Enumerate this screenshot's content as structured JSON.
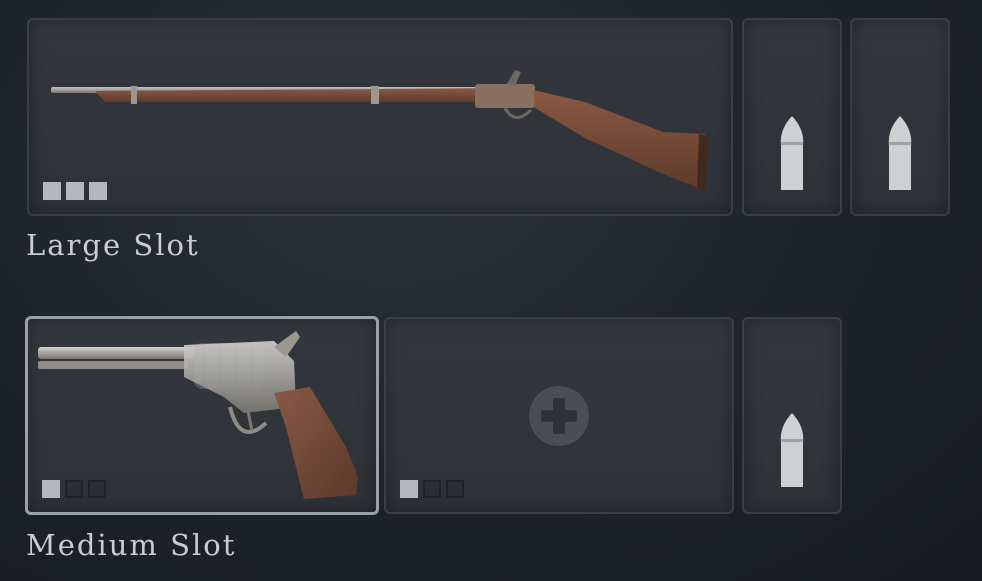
{
  "large_slot": {
    "label": "Large Slot",
    "weapon_icon": "rifle-icon",
    "pips_filled": 3,
    "pips_total": 3,
    "ammo_slots": [
      "bullet-icon",
      "bullet-icon"
    ]
  },
  "medium_slot": {
    "label": "Medium Slot",
    "weapon_icon": "revolver-icon",
    "weapon_pips_filled": 1,
    "empty_slot_icon": "plus-icon",
    "empty_pips_filled": 1,
    "pips_total": 3,
    "ammo_slots": [
      "bullet-icon"
    ]
  },
  "colors": {
    "background": "#1e232a",
    "slot": "#31353a",
    "selected_border": "#9aa0a6",
    "text": "#c9ccd0"
  }
}
